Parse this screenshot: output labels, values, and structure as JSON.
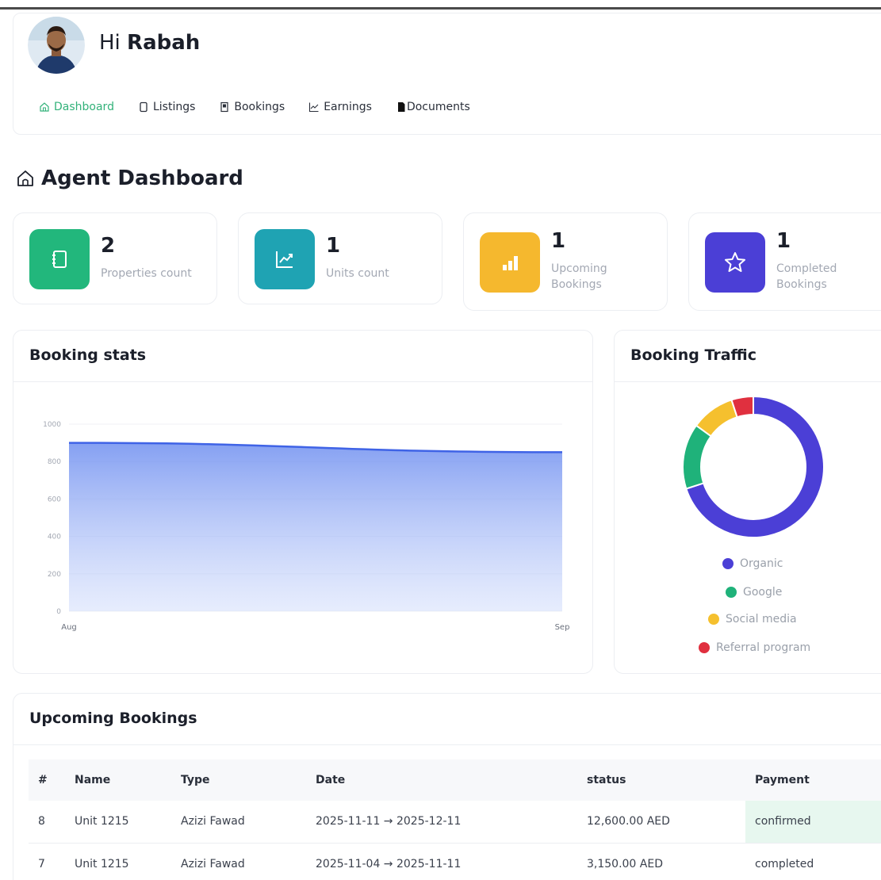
{
  "header": {
    "greeting_prefix": "Hi",
    "user_name": "Rabah"
  },
  "nav": {
    "items": [
      {
        "label": "Dashboard",
        "icon": "home-icon",
        "active": true
      },
      {
        "label": "Listings",
        "icon": "document-icon",
        "active": false
      },
      {
        "label": "Bookings",
        "icon": "bookmark-icon",
        "active": false
      },
      {
        "label": "Earnings",
        "icon": "chart-line-icon",
        "active": false
      },
      {
        "label": "Documents",
        "icon": "file-icon",
        "active": false
      }
    ]
  },
  "page": {
    "title": "Agent Dashboard"
  },
  "stats": [
    {
      "value": "2",
      "label": "Properties count",
      "icon": "notebook-icon",
      "color": "#22b77c"
    },
    {
      "value": "1",
      "label": "Units count",
      "icon": "trend-chart-icon",
      "color": "#1fa3b3"
    },
    {
      "value": "1",
      "label": "Upcoming Bookings",
      "icon": "bar-chart-icon",
      "color": "#f5b82e"
    },
    {
      "value": "1",
      "label": "Completed Bookings",
      "icon": "star-icon",
      "color": "#4b3fd6"
    }
  ],
  "booking_stats": {
    "title": "Booking stats",
    "chart_data": {
      "type": "area",
      "x": [
        "Aug",
        "Sep"
      ],
      "series": [
        {
          "values": [
            900,
            850
          ]
        }
      ],
      "yticks": [
        "1000",
        "800",
        "600",
        "400",
        "200",
        "0"
      ],
      "ylim": [
        0,
        1000
      ],
      "color": "#3f63e6"
    }
  },
  "booking_traffic": {
    "title": "Booking Traffic",
    "chart_data": {
      "type": "pie",
      "categories": [
        "Organic",
        "Google",
        "Social media",
        "Referral program"
      ],
      "values": [
        70,
        15,
        10,
        5
      ],
      "colors": [
        "#4b3fd6",
        "#1fb27a",
        "#f5c02e",
        "#e0303f"
      ]
    }
  },
  "upcoming": {
    "title": "Upcoming Bookings",
    "columns": [
      "#",
      "Name",
      "Type",
      "Date",
      "status",
      "Payment"
    ],
    "rows": [
      [
        "8",
        "Unit 1215",
        "Azizi Fawad",
        "2025-11-11 → 2025-12-11",
        "12,600.00 AED",
        "confirmed"
      ],
      [
        "7",
        "Unit 1215",
        "Azizi Fawad",
        "2025-11-04 → 2025-11-11",
        "3,150.00 AED",
        "completed"
      ]
    ]
  }
}
